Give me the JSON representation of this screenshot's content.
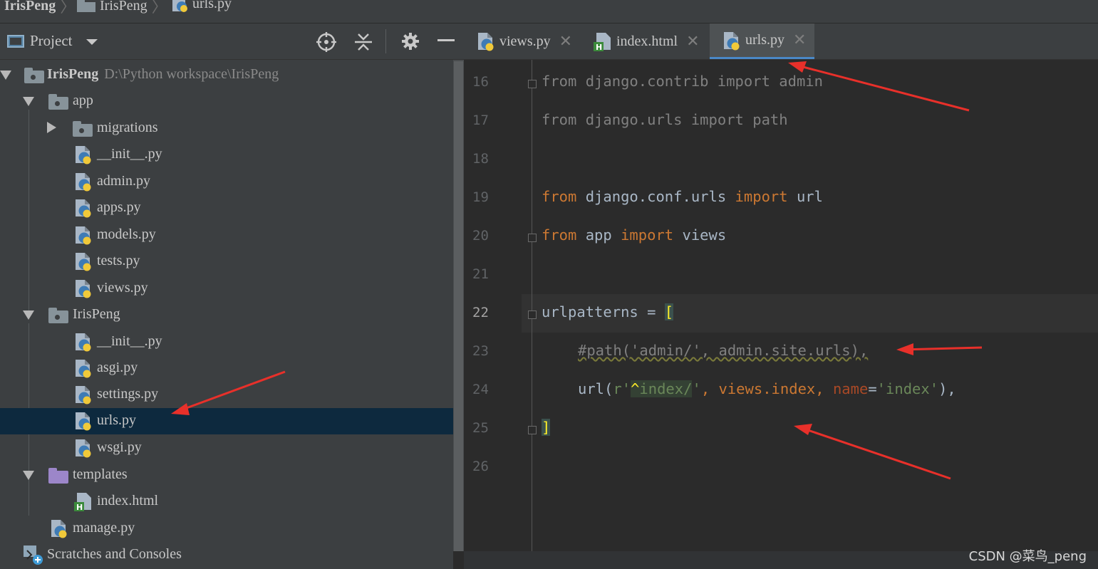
{
  "breadcrumb": {
    "items": [
      "IrisPeng",
      "IrisPeng",
      "urls.py"
    ]
  },
  "project_panel": {
    "title": "Project",
    "toolbar_icons": [
      "crosshair-icon",
      "collapse-all-icon",
      "gear-icon",
      "minimize-icon"
    ]
  },
  "tree": {
    "root": {
      "name": "IrisPeng",
      "path": "D:\\Python workspace\\IrisPeng"
    },
    "app_folder": "app",
    "migrations_folder": "migrations",
    "app_files": [
      "__init__.py",
      "admin.py",
      "apps.py",
      "models.py",
      "tests.py",
      "views.py"
    ],
    "irispeng_folder": "IrisPeng",
    "irispeng_files": [
      "__init__.py",
      "asgi.py",
      "settings.py",
      "urls.py",
      "wsgi.py"
    ],
    "templates_folder": "templates",
    "template_files": [
      "index.html"
    ],
    "manage": "manage.py",
    "scratches": "Scratches and Consoles",
    "selected": "urls.py"
  },
  "tabs": [
    {
      "label": "views.py",
      "type": "python",
      "active": false
    },
    {
      "label": "index.html",
      "type": "html",
      "active": false
    },
    {
      "label": "urls.py",
      "type": "python",
      "active": true
    }
  ],
  "editor": {
    "line_numbers": [
      "16",
      "17",
      "18",
      "19",
      "20",
      "21",
      "22",
      "23",
      "24",
      "25",
      "26"
    ],
    "current_line": "22",
    "lines": {
      "l16": {
        "kw1": "from",
        "mod": " django.contrib ",
        "kw2": "import",
        "name": " admin"
      },
      "l17": {
        "kw1": "from",
        "mod": " django.urls ",
        "kw2": "import",
        "name": " path"
      },
      "l19": {
        "kw1": "from",
        "mod": " django.conf.urls ",
        "kw2": "import",
        "name": " url"
      },
      "l20": {
        "kw1": "from",
        "mod": " app ",
        "kw2": "import",
        "name": " views"
      },
      "l22": {
        "text": "urlpatterns = ",
        "bracket": "["
      },
      "l23": {
        "text": "#path('admin/', admin.site.urls),"
      },
      "l24": {
        "a": "url(",
        "b": "r'",
        "c": "^",
        "d": "index/",
        "e": "'",
        "f": ", views.index, ",
        "g": "name",
        "h": "=",
        "i": "'index'",
        "j": "),"
      },
      "l25": {
        "bracket": "]"
      }
    }
  },
  "colors": {
    "keyword": "#cc7832",
    "string": "#6a8759",
    "param": "#aa4926",
    "annotation_arrow": "#e8302a",
    "selection": "#0d293e"
  },
  "watermark": "CSDN @菜鸟_peng"
}
